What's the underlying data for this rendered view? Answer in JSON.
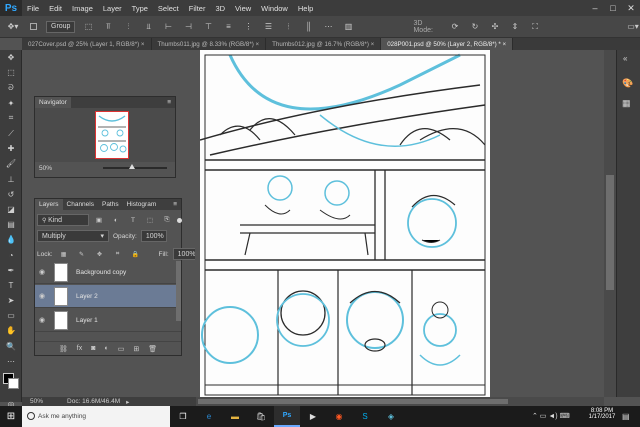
{
  "app": {
    "logo": "Ps"
  },
  "menu": [
    "File",
    "Edit",
    "Image",
    "Layer",
    "Type",
    "Select",
    "Filter",
    "3D",
    "View",
    "Window",
    "Help"
  ],
  "window_controls": {
    "minimize": "–",
    "maximize": "□",
    "close": "✕"
  },
  "options_bar": {
    "auto_select_value": "Group",
    "mode_label": "3D Mode:"
  },
  "doc_tabs": [
    {
      "label": "027Cover.psd @ 25% (Layer 1, RGB/8*)",
      "active": false
    },
    {
      "label": "Thumbs011.jpg @ 8.33% (RGB/8*)",
      "active": false
    },
    {
      "label": "Thumbs012.jpg @ 16.7% (RGB/8*)",
      "active": false
    },
    {
      "label": "028P001.psd @ 50% (Layer 2, RGB/8*) *",
      "active": true
    }
  ],
  "navigator": {
    "title": "Navigator",
    "zoom": "50%"
  },
  "layers_panel": {
    "tabs": [
      "Layers",
      "Channels",
      "Paths",
      "Histogram"
    ],
    "filter": "Kind",
    "blend_mode": "Multiply",
    "opacity_label": "Opacity:",
    "opacity": "100%",
    "lock_label": "Lock:",
    "fill_label": "Fill:",
    "fill": "100%",
    "layers": [
      {
        "name": "Background copy",
        "selected": false
      },
      {
        "name": "Layer 2",
        "selected": true
      },
      {
        "name": "Layer 1",
        "selected": false
      }
    ],
    "bottom_icons": [
      "link-icon",
      "fx-icon",
      "mask-icon",
      "adjustment-icon",
      "folder-icon",
      "new-layer-icon",
      "trash-icon"
    ]
  },
  "status": {
    "zoom": "50%",
    "doc": "Doc: 16.6M/46.4M"
  },
  "taskbar": {
    "search_placeholder": "Ask me anything",
    "time": "8:08 PM",
    "date": "1/17/2017"
  },
  "colors": {
    "accent": "#31a8ff",
    "selected_layer": "#6b7b95",
    "sketch_blue": "#5ec0dc",
    "ink": "#2b2b2b"
  }
}
